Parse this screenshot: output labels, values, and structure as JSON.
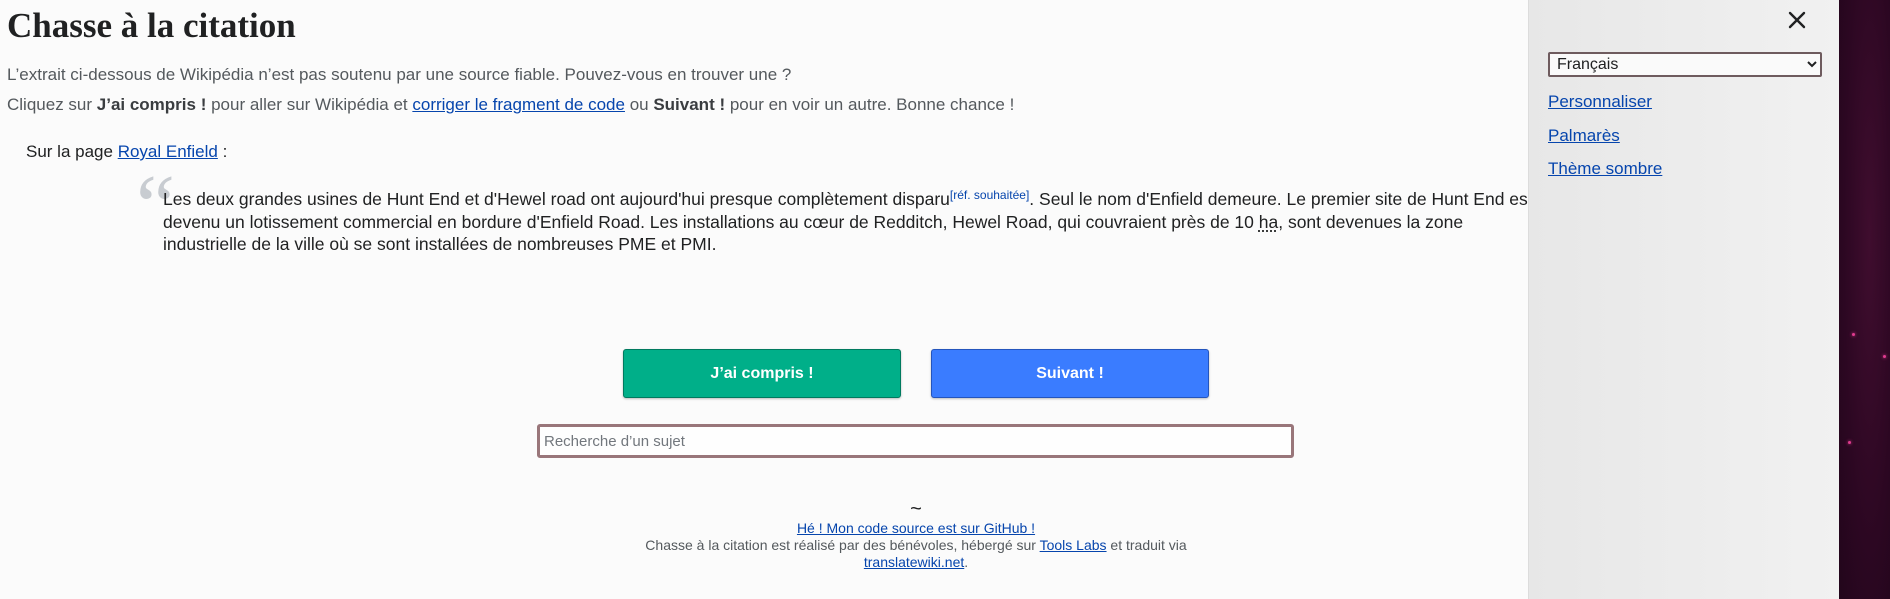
{
  "page": {
    "title": "Chasse à la citation",
    "intro_line1": "L’extrait ci-dessous de Wikipédia n’est pas soutenu par une source fiable. Pouvez-vous en trouver une ?",
    "intro_line2": {
      "part1": "Cliquez sur ",
      "bold1": "J’ai compris !",
      "part2": " pour aller sur Wikipédia et ",
      "link": "corriger le fragment de code",
      "part3": " ou ",
      "bold2": "Suivant !",
      "part4": " pour en voir un autre. Bonne chance !"
    }
  },
  "source_page": {
    "prefix": "Sur la page ",
    "link_text": "Royal Enfield",
    "suffix": " :"
  },
  "snippet": {
    "quote_mark": "“",
    "text_before_ref": "Les deux grandes usines de Hunt End et d'Hewel road ont aujourd'hui presque complètement disparu",
    "citation_needed": "[réf. souhaitée]",
    "text_mid": ". Seul le nom d'Enfield demeure. Le premier site de Hunt End est devenu un lotissement commercial en bordure d'Enfield Road. Les installations au cœur de Redditch, Hewel Road, qui couvraient près de 10 ",
    "unit_abbr": "ha",
    "unit_title": "hectare",
    "text_after": ", sont devenues la zone industrielle de la ville où se sont installées de nombreuses PME et PMI."
  },
  "actions": {
    "understood_label": "J’ai compris !",
    "next_label": "Suivant !"
  },
  "search": {
    "placeholder": "Recherche d’un sujet",
    "value": ""
  },
  "footer": {
    "separator": "~",
    "github_link": "Hé ! Mon code source est sur GitHub !",
    "credit_prefix": "Chasse à la citation est réalisé par des bénévoles, hébergé sur ",
    "tools_link": "Tools Labs",
    "credit_mid": " et traduit via ",
    "translate_link": "translatewiki.net",
    "credit_end": "."
  },
  "sidebar": {
    "language_selected": "Français",
    "links": {
      "customize": "Personnaliser",
      "ranking": "Palmarès",
      "dark_theme": "Thème sombre"
    },
    "close_icon": "close-icon"
  },
  "colors": {
    "understood_button": "#00af89",
    "next_button": "#3a7cff",
    "link": "#0645ad",
    "search_border": "#99767a"
  }
}
